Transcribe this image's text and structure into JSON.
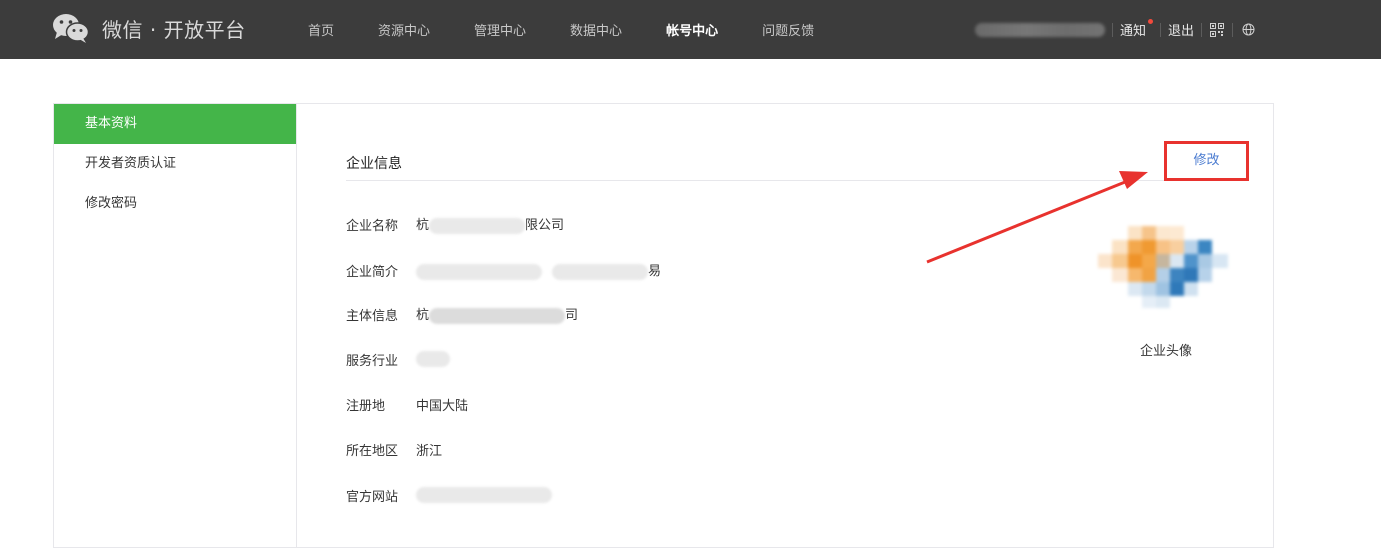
{
  "header": {
    "brand": "微信 · 开放平台",
    "nav": [
      {
        "label": "首页",
        "active": false
      },
      {
        "label": "资源中心",
        "active": false
      },
      {
        "label": "管理中心",
        "active": false
      },
      {
        "label": "数据中心",
        "active": false
      },
      {
        "label": "帐号中心",
        "active": true
      },
      {
        "label": "问题反馈",
        "active": false
      }
    ],
    "notify_label": "通知",
    "logout_label": "退出",
    "icons": [
      "qrcode-icon",
      "globe-icon"
    ]
  },
  "sidebar": {
    "items": [
      {
        "label": "基本资料",
        "active": true
      },
      {
        "label": "开发者资质认证",
        "active": false
      },
      {
        "label": "修改密码",
        "active": false
      }
    ]
  },
  "section": {
    "title": "企业信息",
    "edit_label": "修改"
  },
  "info": {
    "rows": [
      {
        "label": "企业名称",
        "prefix": "杭",
        "suffix": "限公司"
      },
      {
        "label": "企业简介",
        "prefix": "",
        "suffix": "易"
      },
      {
        "label": "主体信息",
        "prefix": "杭",
        "suffix": "司"
      },
      {
        "label": "服务行业",
        "prefix": "",
        "suffix": ""
      },
      {
        "label": "注册地",
        "value": "中国大陆"
      },
      {
        "label": "所在地区",
        "value": "浙江"
      },
      {
        "label": "官方网站",
        "prefix": "",
        "suffix": ""
      }
    ]
  },
  "avatar": {
    "caption": "企业头像"
  },
  "colors": {
    "topbar": "#3c3c3c",
    "active_green": "#44b549",
    "highlight_red": "#e8322e",
    "link_blue": "#4a7bd0"
  }
}
